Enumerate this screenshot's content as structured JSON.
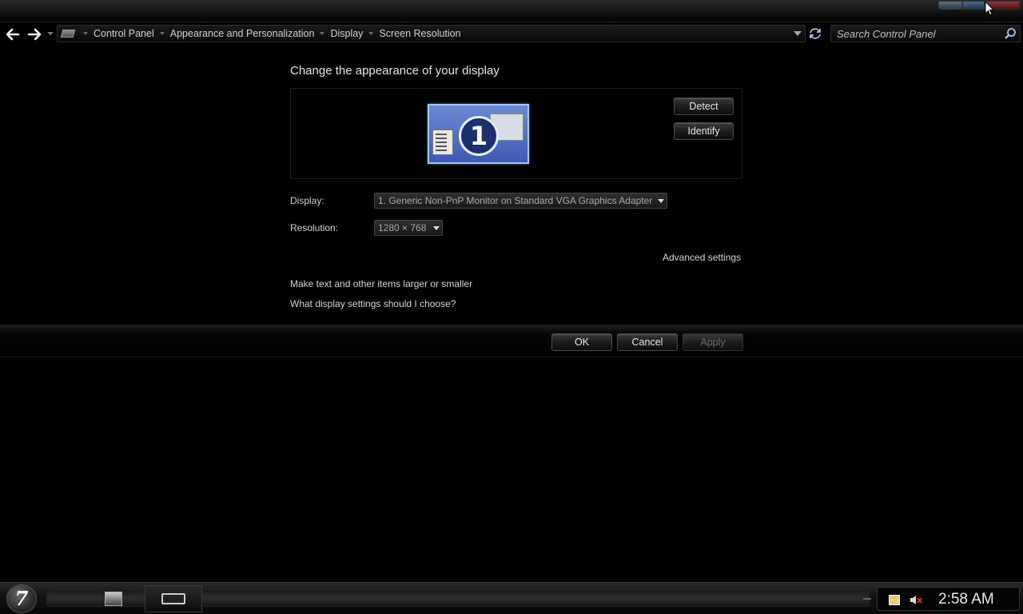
{
  "titlebar": {
    "buttons": [
      "minimize",
      "maximize",
      "close"
    ]
  },
  "nav": {
    "back_icon": "back-arrow-icon",
    "forward_icon": "forward-arrow-icon"
  },
  "address": {
    "breadcrumbs": [
      "Control Panel",
      "Appearance and Personalization",
      "Display",
      "Screen Resolution"
    ]
  },
  "search": {
    "placeholder": "Search Control Panel"
  },
  "main": {
    "title": "Change the appearance of your display",
    "monitor_number": "1",
    "detect_label": "Detect",
    "identify_label": "Identify",
    "display_label": "Display:",
    "display_value": "1. Generic Non-PnP Monitor on Standard VGA Graphics Adapter",
    "resolution_label": "Resolution:",
    "resolution_value": "1280 × 768",
    "advanced_link": "Advanced settings",
    "text_size_link": "Make text and other items larger or smaller",
    "help_link": "What display settings should I choose?"
  },
  "commands": {
    "ok_label": "OK",
    "cancel_label": "Cancel",
    "apply_label": "Apply"
  },
  "taskbar": {
    "start_glyph": "7",
    "clock": "2:58 AM"
  },
  "colors": {
    "background": "#000000",
    "text": "#d8d8d8",
    "monitor_fill": "#4a6ac0",
    "monitor_border": "#9cc8f0"
  }
}
